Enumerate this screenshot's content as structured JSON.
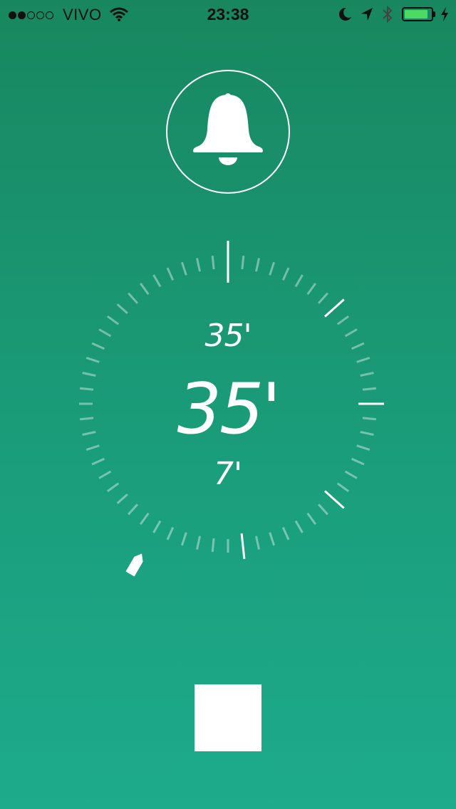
{
  "status_bar": {
    "signal_bars_filled": 2,
    "signal_bars_total": 5,
    "carrier": "VIVO",
    "time": "23:38",
    "battery_level": 0.9,
    "icons": [
      "wifi-icon",
      "moon-icon",
      "location-arrow-icon",
      "bluetooth-icon",
      "battery-icon",
      "charging-bolt-icon"
    ]
  },
  "alarm": {
    "icon": "bell-icon"
  },
  "dial": {
    "tick_count": 60,
    "major_tick_index": 0,
    "highlight_tick_indices": [
      8,
      15,
      22,
      29
    ],
    "readouts": {
      "upper": "35'",
      "main": "35'",
      "lower": "7'"
    }
  },
  "boat_marker": {
    "icon": "boat-icon"
  },
  "controls": {
    "stop_icon": "stop-square-icon"
  },
  "colors": {
    "gradient_top": "#18875f",
    "gradient_bottom": "#1dab8c",
    "foreground": "#ffffff",
    "battery_fill": "#4cd964"
  }
}
